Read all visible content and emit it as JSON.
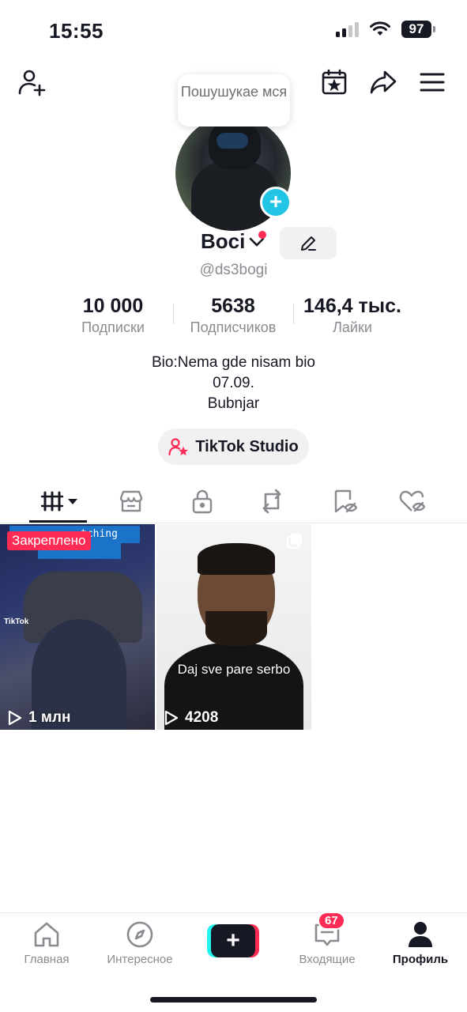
{
  "status_bar": {
    "time": "15:55",
    "battery": "97"
  },
  "tooltip": {
    "text": "Пошушукае мся"
  },
  "profile": {
    "name": "Boci",
    "handle": "@ds3bogi",
    "stats": [
      {
        "value": "10 000",
        "label": "Подписки"
      },
      {
        "value": "5638",
        "label": "Подписчиков"
      },
      {
        "value": "146,4 тыс.",
        "label": "Лайки"
      }
    ],
    "bio_lines": [
      "Bio:Nema gde nisam bio",
      "07.09.",
      "Bubnjar"
    ],
    "studio_label": "TikTok Studio"
  },
  "tabs": [
    {
      "icon": "grid-icon",
      "active": true
    },
    {
      "icon": "shop-icon"
    },
    {
      "icon": "lock-icon"
    },
    {
      "icon": "repost-icon"
    },
    {
      "icon": "bookmark-hidden-icon"
    },
    {
      "icon": "liked-hidden-icon"
    }
  ],
  "videos": [
    {
      "pinned_label": "Закреплено",
      "views": "1 млн",
      "banner_text": "tching",
      "logo_text": "TikTok"
    },
    {
      "overlay_text": "Daj sve pare serbo",
      "views": "4208"
    }
  ],
  "bottom_nav": {
    "home": "Главная",
    "discover": "Интересное",
    "inbox": "Входящие",
    "inbox_badge": "67",
    "profile": "Профиль"
  },
  "colors": {
    "accent": "#fe2c55",
    "cyan": "#25f4ee",
    "avatar_add": "#22c4e6"
  }
}
